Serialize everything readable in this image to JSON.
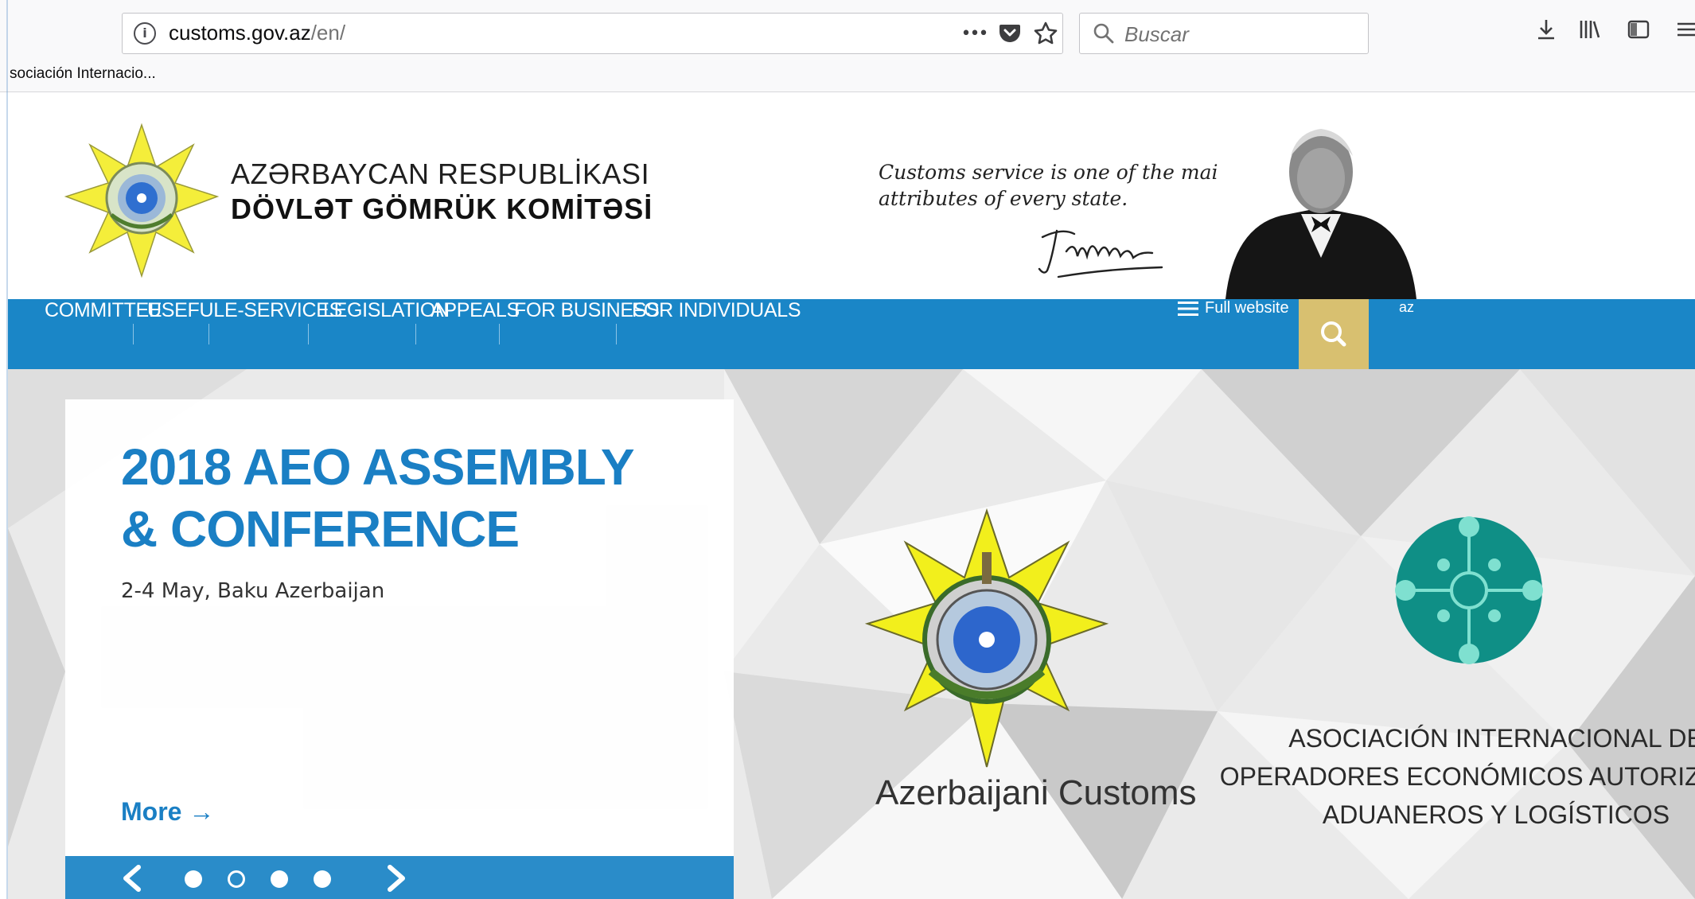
{
  "browser": {
    "url_host": "customs.gov.az",
    "url_path": "/en/",
    "url_more": "•••",
    "search_placeholder": "Buscar",
    "bookmark_label": "sociación Internacio..."
  },
  "header": {
    "brand_line1": "AZƏRBAYCAN RESPUBLİKASI",
    "brand_line2": "DÖVLƏT GÖMRÜK KOMİTƏSİ",
    "quote_line1": "Customs service is one of the main",
    "quote_line2": "attributes of every state."
  },
  "nav": {
    "items": [
      "COMMITTEE",
      "USEFUL",
      "E-SERVICES",
      "LEGISLATION",
      "APPEALS",
      "FOR BUSINESS",
      "FOR INDIVIDUALS"
    ],
    "full_website": "Full website",
    "lang": "az"
  },
  "hero": {
    "title": "2018 AEO ASSEMBLY & CONFERENCE",
    "subtitle": "2-4 May, Baku Azerbaijan",
    "more": "More →",
    "slides": 4,
    "active_slide": 2,
    "customs_caption": "Azerbaijani Customs",
    "aeo_caption_1": "ASOCIACIÓN INTERNACIONAL DE",
    "aeo_caption_2": "OPERADORES ECONÓMICOS AUTORIZADOS",
    "aeo_caption_3": "ADUANEROS Y LOGÍSTICOS"
  },
  "colors": {
    "nav_blue": "#1a86c7",
    "accent_gold": "#d8c070",
    "title_blue": "#1a7fc4",
    "aeo_teal": "#0f8f86"
  },
  "icons": {
    "url_info": "info-icon",
    "pocket": "pocket-icon",
    "star": "bookmark-star-icon",
    "search": "search-icon",
    "download": "download-icon",
    "library": "library-icon",
    "sidebar": "sidebar-icon",
    "menu": "hamburger-menu-icon"
  }
}
